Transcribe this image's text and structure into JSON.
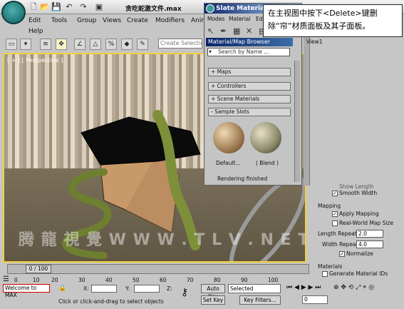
{
  "title_bar": {
    "file_name": "贪吃蛇激文件.max",
    "menus": [
      "Edit",
      "Tools",
      "Group",
      "Views",
      "Create",
      "Modifiers",
      "Anim"
    ],
    "help_label": "Help"
  },
  "slate": {
    "title": "Slate Material",
    "menus": [
      "Modes",
      "Material",
      "Edit"
    ],
    "view_tab": "View1",
    "browser_title": "Material/Map Browser",
    "search_placeholder": "Search by Name ...",
    "rollouts": [
      "Maps",
      "Controllers",
      "Scene Materials",
      "Sample Slots"
    ],
    "slot1_label": "Default...",
    "slot2_label": "( Blend )",
    "status": "Rendering finished"
  },
  "callout": {
    "text": "在主视图中按下<Delete>键删除“帘”材质面板及其子面板。"
  },
  "toolbar": {
    "selection_set_placeholder": "Create Selection S"
  },
  "viewport": {
    "label": "[ + ] [ Perspective ]",
    "watermark": "腾 龍 視 覺 W W W . T L V . N E T"
  },
  "props": {
    "show_label": "Show Length",
    "smooth_label": "Smooth Width",
    "mapping_header": "Mapping",
    "apply_label": "Apply Mapping",
    "realworld_label": "Real-World Map Size",
    "length_label": "Length Repeat:",
    "length_value": "2.0",
    "width_label": "Width Repeat:",
    "width_value": "4.0",
    "normalize_label": "Normalize",
    "materials_header": "Materials",
    "genmat_label": "Generate Material IDs"
  },
  "timeline": {
    "counter": "0 / 100",
    "ticks": [
      "0",
      "10",
      "20",
      "30",
      "40",
      "50",
      "60",
      "70",
      "80",
      "90",
      "100"
    ]
  },
  "status_bar": {
    "script_label": "Welcome to MAX",
    "prompt": "Click or click-and-drag to select objects",
    "x_label": "X:",
    "y_label": "Y:",
    "z_label": "Z:",
    "auto_key": "Auto Key",
    "selected": "Selected",
    "set_key": "Set Key",
    "key_filters": "Key Filters...",
    "frame": "0"
  }
}
